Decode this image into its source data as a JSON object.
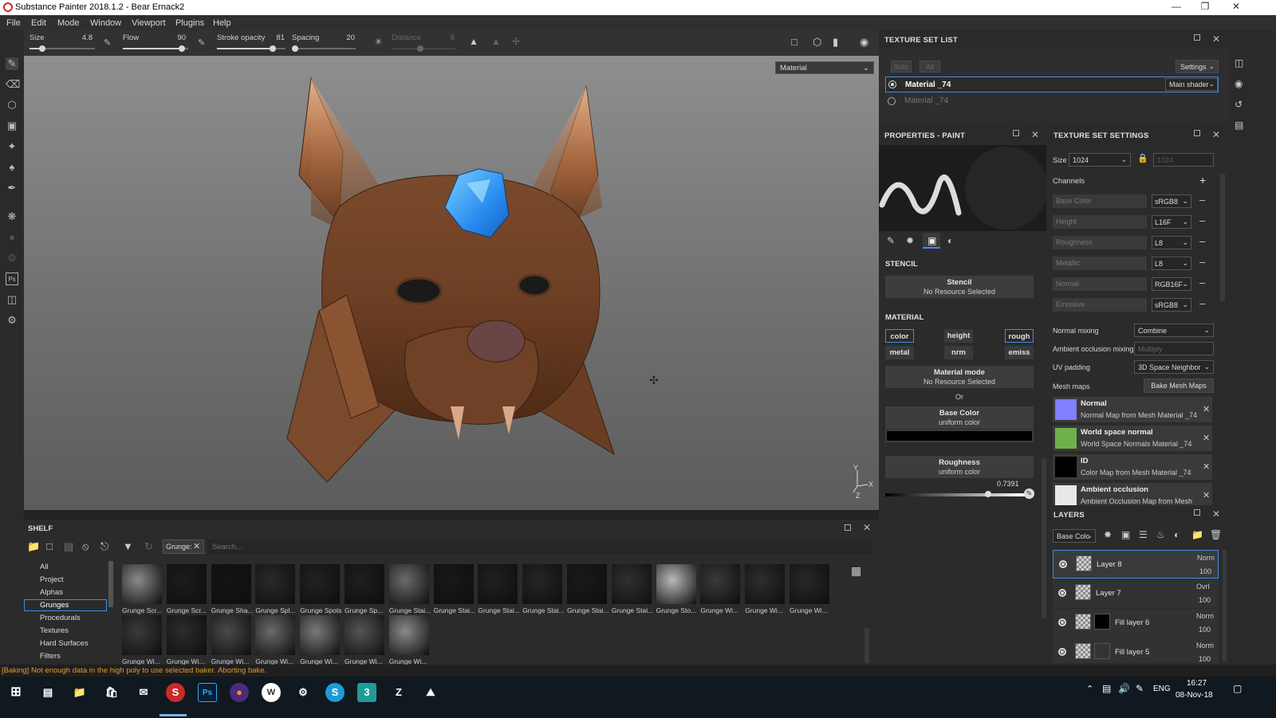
{
  "window": {
    "title": "Substance Painter 2018.1.2 - Bear Ernack2"
  },
  "menu": [
    "File",
    "Edit",
    "Mode",
    "Window",
    "Viewport",
    "Plugins",
    "Help"
  ],
  "tool_options": {
    "size_label": "Size",
    "size_value": "4.8",
    "size_fraction": 0.2,
    "flow_label": "Flow",
    "flow_value": "90",
    "flow_fraction": 0.9,
    "stroke_label": "Stroke opacity",
    "stroke_value": "81",
    "stroke_fraction": 0.81,
    "spacing_label": "Spacing",
    "spacing_value": "20",
    "spacing_fraction": 0.02,
    "distance_label": "Distance",
    "distance_value": "8"
  },
  "viewport": {
    "material_select": "Material",
    "axis_y": "Y",
    "axis_x": "X",
    "axis_z": "Z"
  },
  "texture_set_list": {
    "title": "TEXTURE SET LIST",
    "solo": "Solo",
    "all": "All",
    "settings": "Settings",
    "items": [
      {
        "name": "Material _74",
        "shader": "Main shader"
      },
      {
        "name": "Material _74"
      }
    ]
  },
  "properties": {
    "title": "PROPERTIES - PAINT",
    "stencil_section": "STENCIL",
    "stencil_label": "Stencil",
    "stencil_value": "No Resource Selected",
    "material_section": "MATERIAL",
    "buttons": [
      "color",
      "height",
      "rough",
      "metal",
      "nrm",
      "emiss"
    ],
    "material_mode_label": "Material mode",
    "material_mode_value": "No Resource Selected",
    "or": "Or",
    "base_color_label": "Base Color",
    "base_color_value": "uniform color",
    "base_color_swatch": "#000000",
    "roughness_label": "Roughness",
    "roughness_value": "uniform color",
    "roughness_number": "0.7391"
  },
  "texture_set_settings": {
    "title": "TEXTURE SET SETTINGS",
    "size_label": "Size",
    "size_value": "1024",
    "size_value2": "1024",
    "channels_label": "Channels",
    "channels": [
      {
        "name": "Base Color",
        "format": "sRGB8"
      },
      {
        "name": "Height",
        "format": "L16F"
      },
      {
        "name": "Roughness",
        "format": "L8"
      },
      {
        "name": "Metallic",
        "format": "L8"
      },
      {
        "name": "Normal",
        "format": "RGB16F"
      },
      {
        "name": "Emissive",
        "format": "sRGB8"
      }
    ],
    "normal_mixing_label": "Normal mixing",
    "normal_mixing_value": "Combine",
    "ao_mixing_label": "Ambient occlusion mixing",
    "ao_mixing_value": "Multiply",
    "uv_padding_label": "UV padding",
    "uv_padding_value": "3D Space Neighbor",
    "mesh_maps_label": "Mesh maps",
    "bake_button": "Bake Mesh Maps",
    "mesh_maps": [
      {
        "name": "Normal",
        "desc": "Normal Map from Mesh Material _74",
        "color": "#7f7fff"
      },
      {
        "name": "World space normal",
        "desc": "World Space Normals Material _74",
        "color": "#6fb04a"
      },
      {
        "name": "ID",
        "desc": "Color Map from Mesh Material _74",
        "color": "#000000"
      },
      {
        "name": "Ambient occlusion",
        "desc": "Ambient Occlusion Map from Mesh Material _74",
        "color": "#e8e8e8"
      }
    ]
  },
  "layers": {
    "title": "LAYERS",
    "channel_select": "Base Colc",
    "items": [
      {
        "name": "Layer 8",
        "blend": "Norm",
        "opacity": "100"
      },
      {
        "name": "Layer 7",
        "blend": "Ovrl",
        "opacity": "100"
      },
      {
        "name": "Fill layer 6",
        "blend": "Norm",
        "opacity": "100"
      },
      {
        "name": "Fill layer 5",
        "blend": "Norm",
        "opacity": "100"
      }
    ]
  },
  "shelf": {
    "title": "SHELF",
    "filter_tag": "Grunge:",
    "search_placeholder": "Search...",
    "categories": [
      "All",
      "Project",
      "Alphas",
      "Grunges",
      "Procedurals",
      "Textures",
      "Hard Surfaces",
      "Filters"
    ],
    "selected_category": "Grunges",
    "row1": [
      "Grunge Scr...",
      "Grunge Scr...",
      "Grunge Sha...",
      "Grunge Spl...",
      "Grunge Spots",
      "Grunge Sp...",
      "Grunge Stai...",
      "Grunge Stai...",
      "Grunge Stai...",
      "Grunge Stai...",
      "Grunge Stai...",
      "Grunge Stai...",
      "Grunge Sto...",
      "Grunge Wi...",
      "Grunge Wi...",
      "Grunge Wi..."
    ],
    "row2": [
      "Grunge Wi...",
      "Grunge Wi...",
      "Grunge Wi...",
      "Grunge Wi...",
      "Grunge Wi...",
      "Grunge Wi...",
      "Grunge Wi..."
    ]
  },
  "status": {
    "message": "[Baking] Not enough data in the high poly to use selected baker. Aborting bake."
  },
  "taskbar": {
    "lang": "ENG",
    "time": "16:27",
    "date": "08-Nov-18"
  }
}
